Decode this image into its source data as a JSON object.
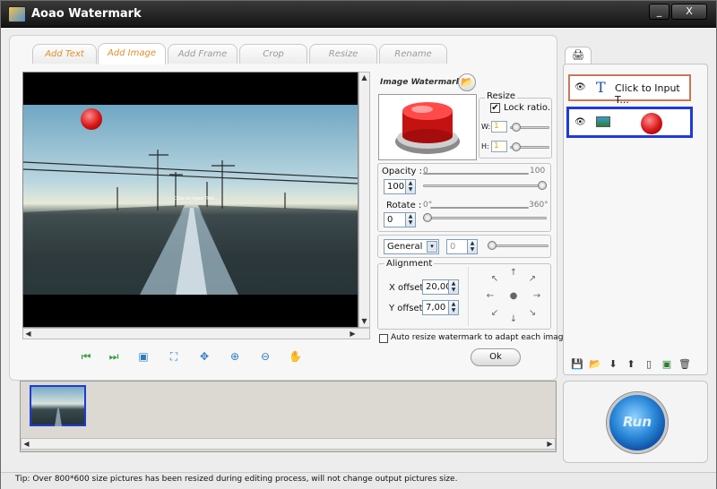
{
  "window": {
    "title": "Aoao Watermark",
    "controls": {
      "minimize": "_",
      "maximize": "□",
      "close": "X"
    }
  },
  "tabs": [
    {
      "label": "Add Text"
    },
    {
      "label": "Add Image"
    },
    {
      "label": "Add Frame"
    },
    {
      "label": "Crop"
    },
    {
      "label": "Resize"
    },
    {
      "label": "Rename"
    }
  ],
  "canvas": {
    "overlay_caption": "Click to Input Text..."
  },
  "viewer_toolbar": [
    {
      "icon": "first-icon",
      "glyph": "⏮"
    },
    {
      "icon": "last-icon",
      "glyph": "⏭"
    },
    {
      "icon": "fit-screen-icon",
      "glyph": "▣"
    },
    {
      "icon": "actual-size-icon",
      "glyph": "⛶"
    },
    {
      "icon": "center-icon",
      "glyph": "✥"
    },
    {
      "icon": "zoom-in-icon",
      "glyph": "⊕"
    },
    {
      "icon": "zoom-out-icon",
      "glyph": "⊖"
    },
    {
      "icon": "hand-icon",
      "glyph": "✋"
    }
  ],
  "image_watermark": {
    "heading": "Image Watermark",
    "resize_label": "Resize",
    "lock_ratio_label": "Lock ratio.",
    "lock_ratio_checked": true,
    "w_label": "W:",
    "h_label": "H:",
    "w_value": "1",
    "h_value": "1"
  },
  "opacity": {
    "label": "Opacity :",
    "value": "100",
    "min_label": "0",
    "max_label": "100",
    "level": 1.0
  },
  "rotate": {
    "label": "Rotate :",
    "value": "0",
    "min_label": "0°",
    "max_label": "360°",
    "level": 0.0
  },
  "blend": {
    "mode": "General",
    "value": "0"
  },
  "alignment": {
    "label": "Alignment",
    "x_offset_label": "X offset:",
    "x_offset_value": "20,00",
    "y_offset_label": "Y offset:",
    "y_offset_value": "7,00"
  },
  "auto_resize": {
    "label": "Auto resize watermark to adapt each image.",
    "checked": false
  },
  "ok_label": "Ok",
  "layers": [
    {
      "type": "text",
      "label": "Click to Input T..."
    },
    {
      "type": "image",
      "label": ""
    }
  ],
  "run_label": "Run",
  "status": {
    "tip": "Tip: Over 800*600 size pictures has been resized during editing process, will not change output pictures size."
  },
  "colors": {
    "accent_orange": "#e08e2a",
    "selection_blue": "#1e3ad6",
    "run_blue": "#2b88d8"
  }
}
